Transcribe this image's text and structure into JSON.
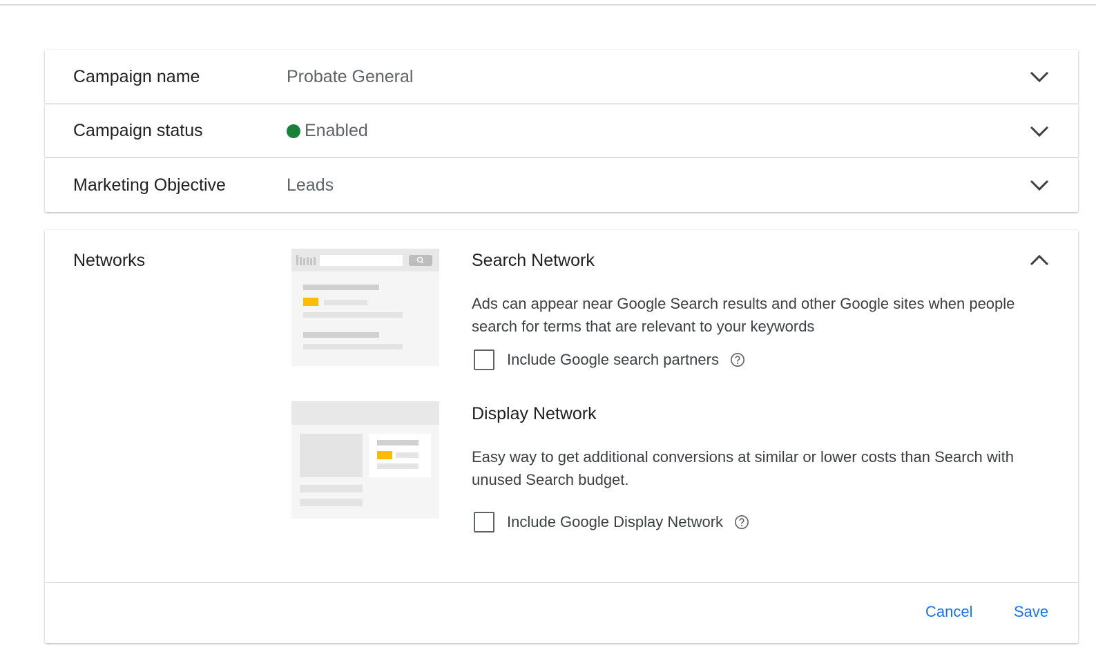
{
  "settings": {
    "campaign_name": {
      "label": "Campaign name",
      "value": "Probate General"
    },
    "campaign_status": {
      "label": "Campaign status",
      "value": "Enabled",
      "status_color": "#188038"
    },
    "marketing_objective": {
      "label": "Marketing Objective",
      "value": "Leads"
    }
  },
  "networks": {
    "label": "Networks",
    "search": {
      "title": "Search Network",
      "description": "Ads can appear near Google Search results and other Google sites when people search for terms that are relevant to your keywords",
      "checkbox_label": "Include Google search partners",
      "checked": false
    },
    "display": {
      "title": "Display Network",
      "description": "Easy way to get additional conversions at similar or lower costs than Search with unused Search budget.",
      "checkbox_label": "Include Google Display Network",
      "checked": false
    },
    "actions": {
      "cancel": "Cancel",
      "save": "Save"
    }
  },
  "colors": {
    "accent": "#1a73e8",
    "highlight": "#fbbc04"
  }
}
